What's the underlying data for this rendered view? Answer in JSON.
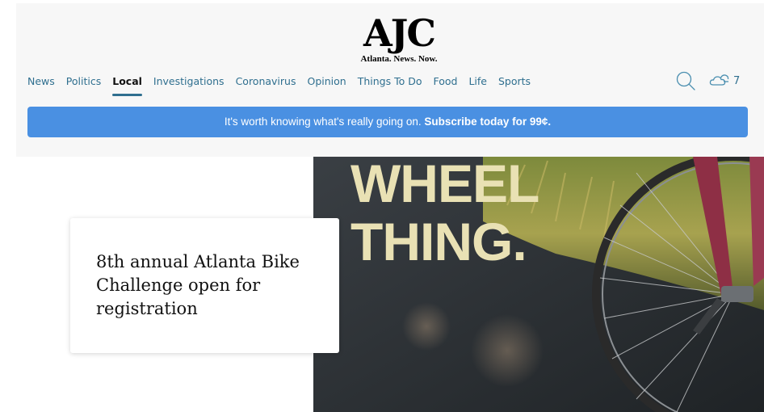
{
  "brand": {
    "logo": "AJC",
    "tagline": "Atlanta. News. Now."
  },
  "nav": {
    "items": [
      {
        "label": "News",
        "active": false
      },
      {
        "label": "Politics",
        "active": false
      },
      {
        "label": "Local",
        "active": true
      },
      {
        "label": "Investigations",
        "active": false
      },
      {
        "label": "Coronavirus",
        "active": false
      },
      {
        "label": "Opinion",
        "active": false
      },
      {
        "label": "Things To Do",
        "active": false
      },
      {
        "label": "Food",
        "active": false
      },
      {
        "label": "Life",
        "active": false
      },
      {
        "label": "Sports",
        "active": false
      }
    ]
  },
  "utility": {
    "search_icon": "search-icon",
    "weather_icon": "partly-cloudy-icon",
    "weather_temp": "7"
  },
  "promo": {
    "lead": "It's worth knowing what's really going on.",
    "cta": "Subscribe today for 99¢."
  },
  "hero": {
    "image_text_line1": "WHEEL",
    "image_text_line2": "THING."
  },
  "story": {
    "headline": "8th annual Atlanta Bike Challenge open for registration"
  },
  "colors": {
    "header_bg": "#f7f7f7",
    "nav_link": "#2f6f8f",
    "promo_bg": "#4a90e2"
  }
}
